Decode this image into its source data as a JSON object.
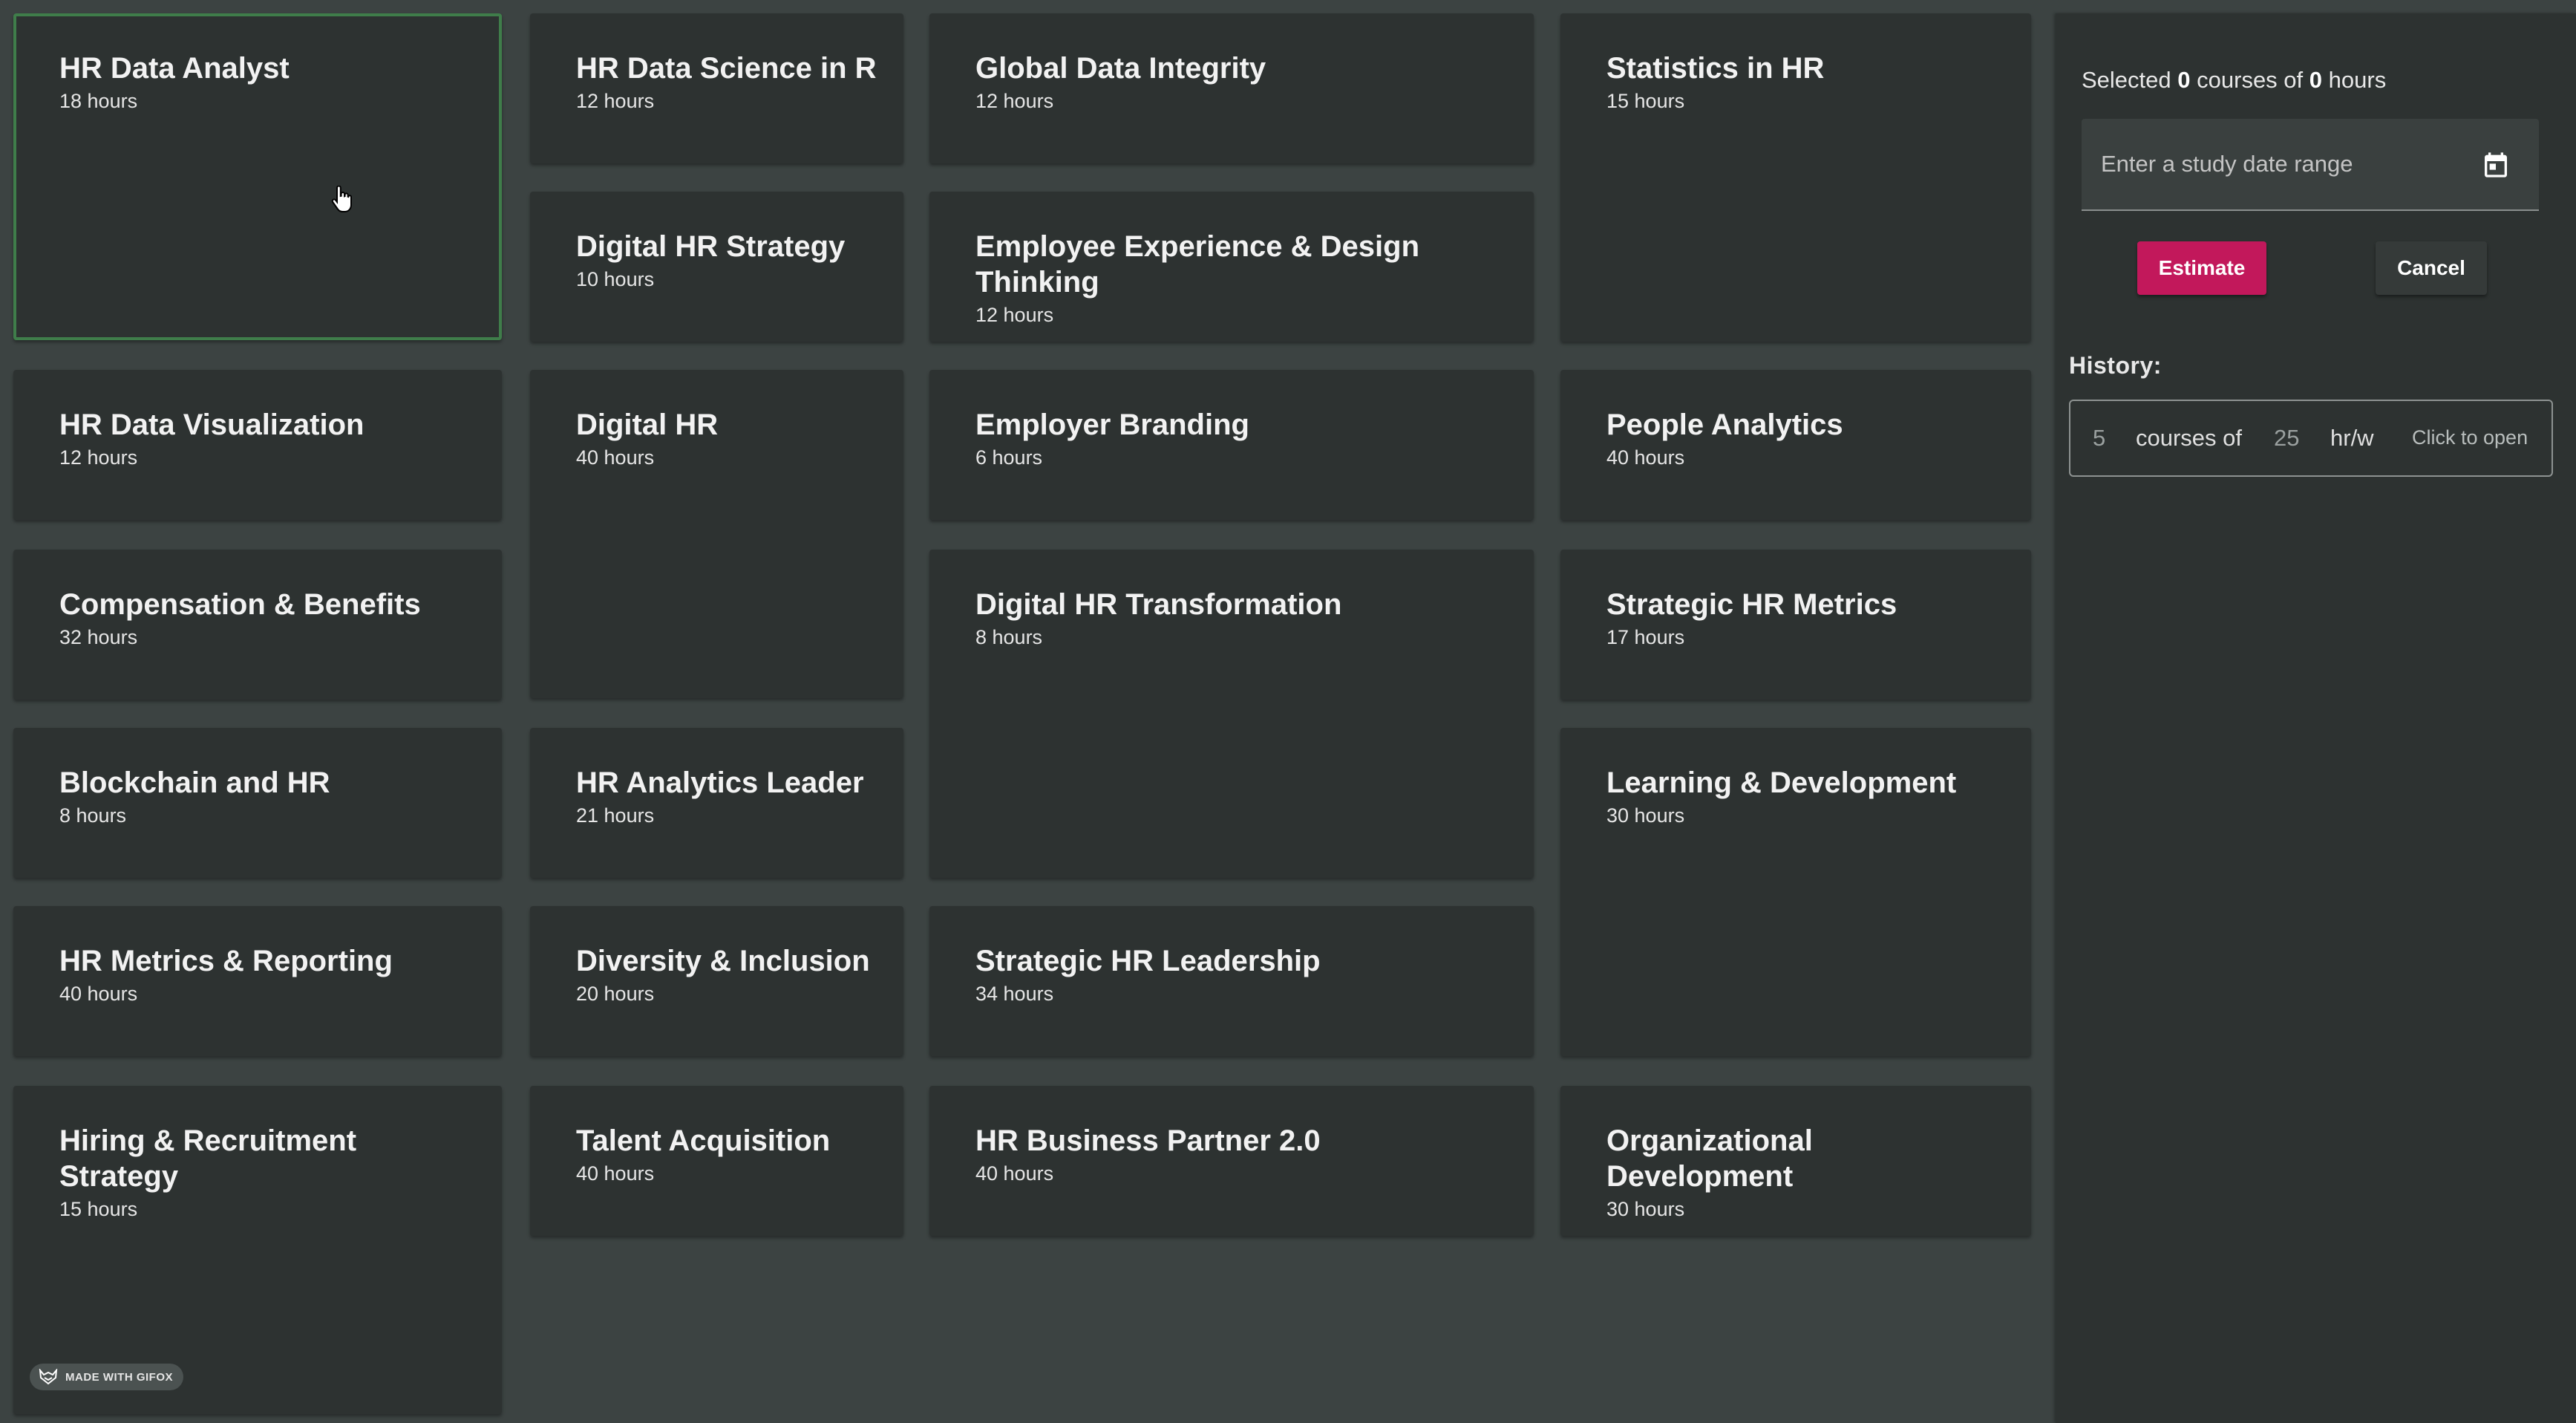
{
  "courses": [
    {
      "title": "HR Data Analyst",
      "hours": "18 hours",
      "selected": true
    },
    {
      "title": "HR Data Science in R",
      "hours": "12 hours"
    },
    {
      "title": "Global Data Integrity",
      "hours": "12 hours"
    },
    {
      "title": "Statistics in HR",
      "hours": "15 hours"
    },
    {
      "title": "Digital HR Strategy",
      "hours": "10 hours"
    },
    {
      "title": "Employee Experience & Design Thinking",
      "hours": "12 hours"
    },
    {
      "title": "HR Data Visualization",
      "hours": "12 hours"
    },
    {
      "title": "Digital HR",
      "hours": "40 hours"
    },
    {
      "title": "Employer Branding",
      "hours": "6 hours"
    },
    {
      "title": "People Analytics",
      "hours": "40 hours"
    },
    {
      "title": "Compensation & Benefits",
      "hours": "32 hours"
    },
    {
      "title": "Digital HR Transformation",
      "hours": "8 hours"
    },
    {
      "title": "Strategic HR Metrics",
      "hours": "17 hours"
    },
    {
      "title": "Blockchain and HR",
      "hours": "8 hours"
    },
    {
      "title": "HR Analytics Leader",
      "hours": "21 hours"
    },
    {
      "title": "Learning & Development",
      "hours": "30 hours"
    },
    {
      "title": "HR Metrics & Reporting",
      "hours": "40 hours"
    },
    {
      "title": "Diversity & Inclusion",
      "hours": "20 hours"
    },
    {
      "title": "Strategic HR Leadership",
      "hours": "34 hours"
    },
    {
      "title": "Hiring & Recruitment Strategy",
      "hours": "15 hours"
    },
    {
      "title": "Talent Acquisition",
      "hours": "40 hours"
    },
    {
      "title": "HR Business Partner 2.0",
      "hours": "40 hours"
    },
    {
      "title": "Organizational Development",
      "hours": "30 hours"
    }
  ],
  "panel": {
    "summary_prefix": "Selected",
    "selected_count": "0",
    "summary_mid": "courses of",
    "selected_hours": "0",
    "summary_suffix": "hours",
    "date_placeholder": "Enter a study date range",
    "estimate_label": "Estimate",
    "cancel_label": "Cancel",
    "history_label": "History:",
    "history": [
      {
        "courses": "5",
        "courses_text": "courses of",
        "hours": "25",
        "unit": "hr/w",
        "action": "Click to open"
      }
    ]
  },
  "badge": {
    "text": "MADE WITH GIFOX"
  },
  "colors": {
    "background": "#3c4342",
    "card": "#2d3231",
    "selected_border": "#3f7d4a",
    "estimate_button": "#c2185b",
    "cancel_button": "#353a39"
  }
}
